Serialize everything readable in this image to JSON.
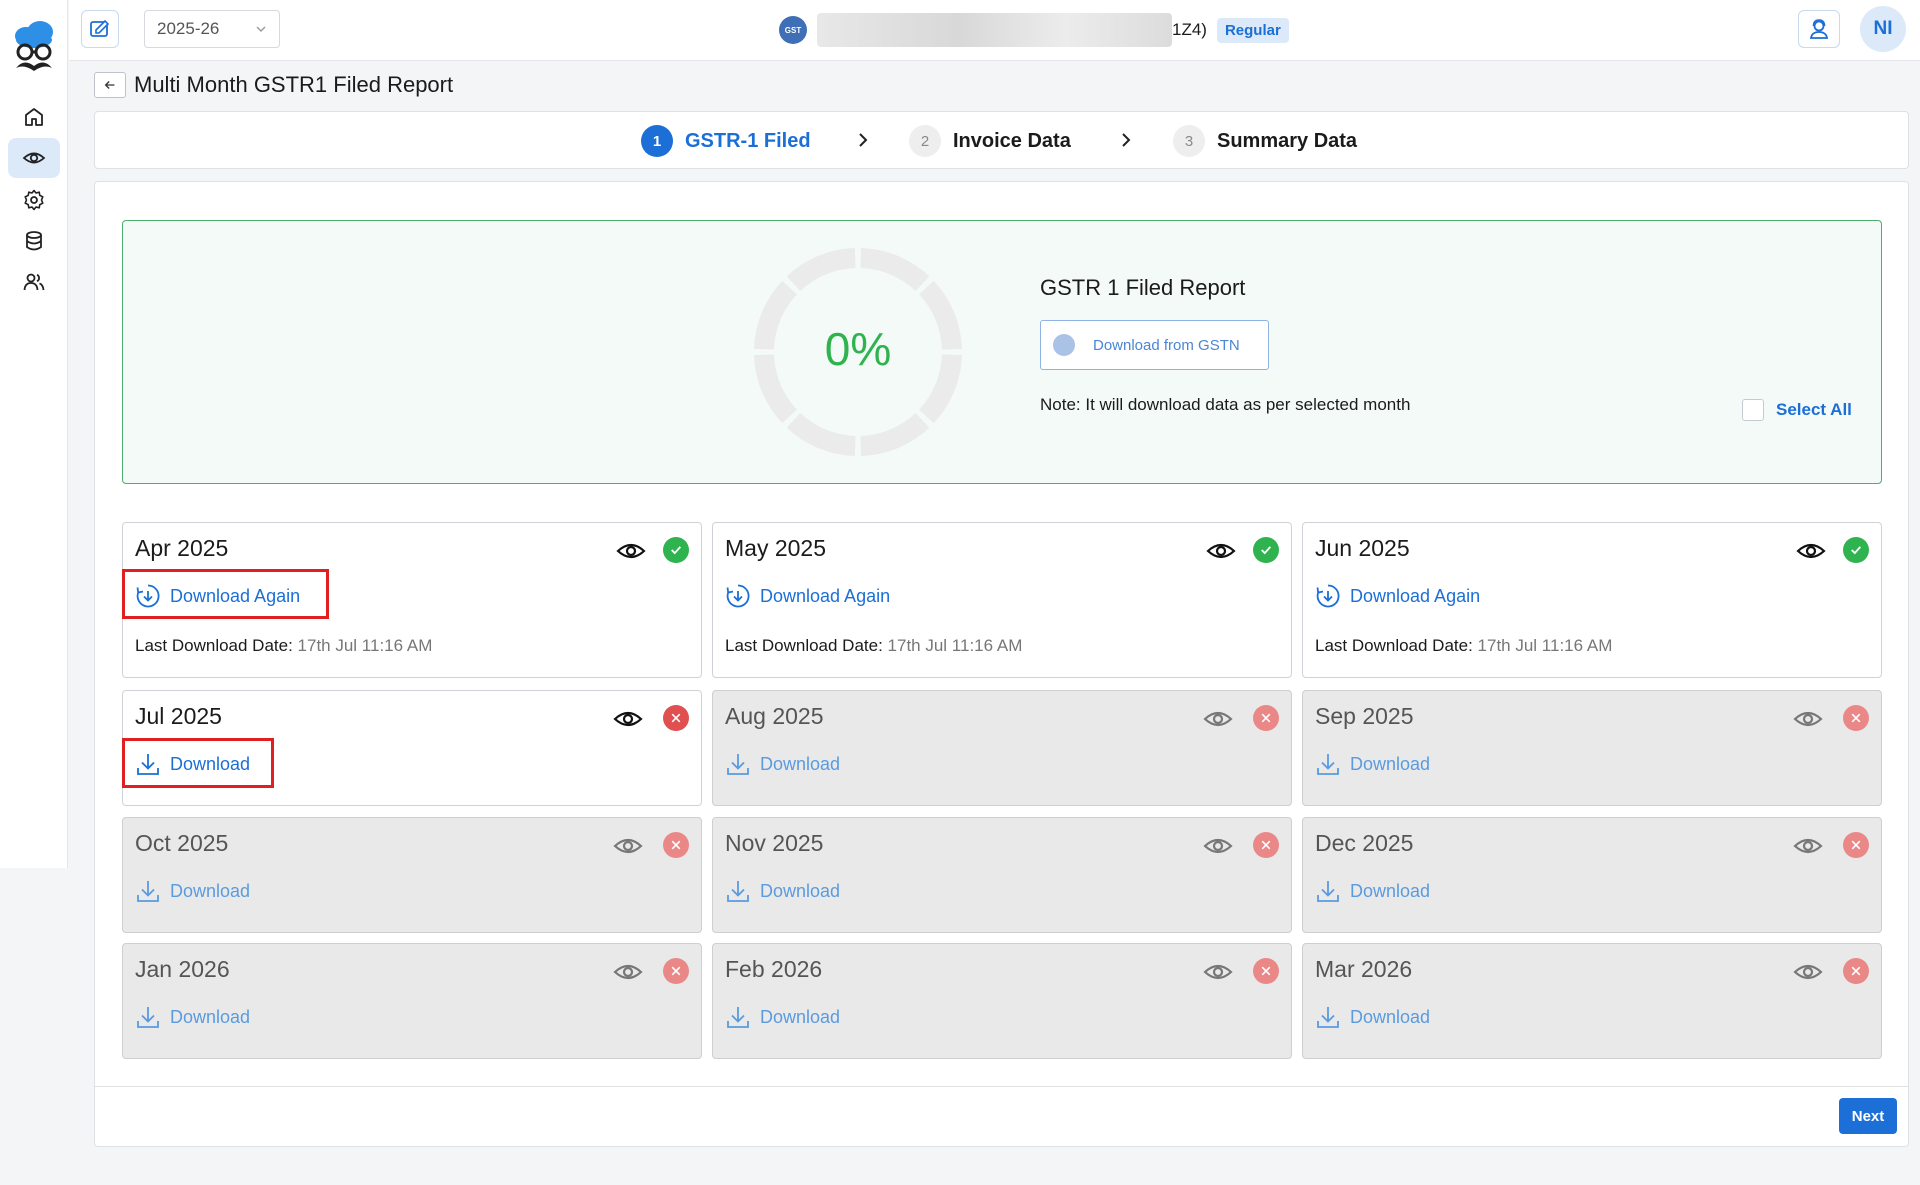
{
  "topbar": {
    "financial_year": "2025-26",
    "gstin_suffix": "1Z4)",
    "gst_logo_text": "GST",
    "registration_type": "Regular",
    "user_initials": "NI"
  },
  "page": {
    "title": "Multi Month GSTR1 Filed Report"
  },
  "stepper": {
    "steps": [
      {
        "num": "1",
        "label": "GSTR-1 Filed"
      },
      {
        "num": "2",
        "label": "Invoice Data"
      },
      {
        "num": "3",
        "label": "Summary Data"
      }
    ]
  },
  "summary": {
    "progress_text": "0%",
    "progress_value": 0,
    "report_title": "GSTR 1 Filed Report",
    "download_button": "Download from GSTN",
    "note": "Note: It will download data as per selected month",
    "select_all": "Select All"
  },
  "months": [
    {
      "name": "Apr 2025",
      "status": "downloaded",
      "action": "Download Again",
      "last_label": "Last Download Date:",
      "last_value": "17th Jul 11:16 AM"
    },
    {
      "name": "May 2025",
      "status": "downloaded",
      "action": "Download Again",
      "last_label": "Last Download Date:",
      "last_value": "17th Jul 11:16 AM"
    },
    {
      "name": "Jun 2025",
      "status": "downloaded",
      "action": "Download Again",
      "last_label": "Last Download Date:",
      "last_value": "17th Jul 11:16 AM"
    },
    {
      "name": "Jul 2025",
      "status": "pending",
      "action": "Download"
    },
    {
      "name": "Aug 2025",
      "status": "disabled",
      "action": "Download"
    },
    {
      "name": "Sep 2025",
      "status": "disabled",
      "action": "Download"
    },
    {
      "name": "Oct 2025",
      "status": "disabled",
      "action": "Download"
    },
    {
      "name": "Nov 2025",
      "status": "disabled",
      "action": "Download"
    },
    {
      "name": "Dec 2025",
      "status": "disabled",
      "action": "Download"
    },
    {
      "name": "Jan 2026",
      "status": "disabled",
      "action": "Download"
    },
    {
      "name": "Feb 2026",
      "status": "disabled",
      "action": "Download"
    },
    {
      "name": "Mar 2026",
      "status": "disabled",
      "action": "Download"
    }
  ],
  "footer": {
    "next": "Next"
  },
  "colors": {
    "primary": "#1b6fd6",
    "success": "#2fb34f",
    "danger": "#e05050",
    "highlight": "#e02020"
  }
}
